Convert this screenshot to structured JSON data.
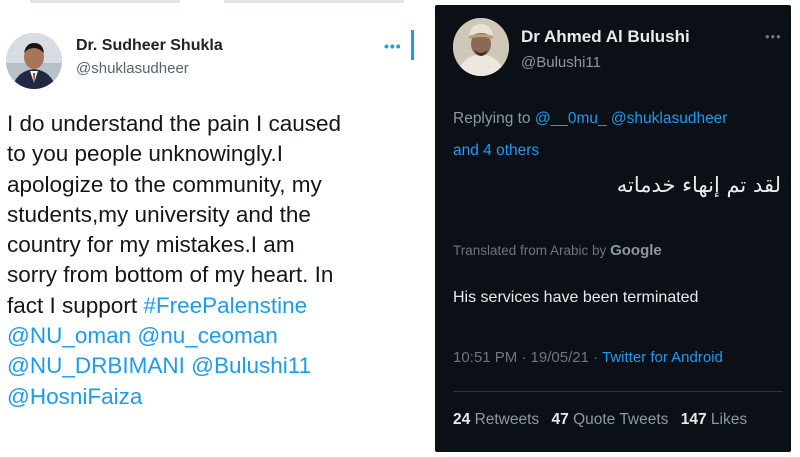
{
  "left_tweet": {
    "author_name": "Dr. Sudheer Shukla",
    "author_handle": "@shuklasudheer",
    "more_icon": "ellipsis-icon",
    "body_text": "I do understand the pain I caused\nto you people unknowingly.I\napologize to the community, my\nstudents,my university  and the\ncountry for my mistakes.I am\nsorry from bottom of my heart. In\nfact I support ",
    "hashtag": "#FreePalenstine",
    "mentions_line1": "@NU_oman @nu_ceoman",
    "mentions_line2": "@NU_DRBIMANI @Bulushi11",
    "mentions_line3": "@HosniFaiza",
    "link_color": "#1d9bf0"
  },
  "right_tweet": {
    "author_name": "Dr Ahmed Al Bulushi",
    "author_handle": "@Bulushi11",
    "more_icon": "ellipsis-icon",
    "replying_prefix": "Replying to ",
    "replying_to": "@__0mu_ @shuklasudheer",
    "replying_others": "and 4 others",
    "arabic_text": "لقد تم إنهاء خدماته",
    "translated_from": "Translated from Arabic by ",
    "translated_by": "Google",
    "translation": "His services have been terminated",
    "timestamp": "10:51 PM · 19/05/21 · ",
    "source": "Twitter for Android",
    "retweets_count": "24",
    "retweets_label": "Retweets",
    "quotes_count": "47",
    "quotes_label": "Quote Tweets",
    "likes_count": "147",
    "likes_label": "Likes",
    "background": "#0b0f16"
  }
}
